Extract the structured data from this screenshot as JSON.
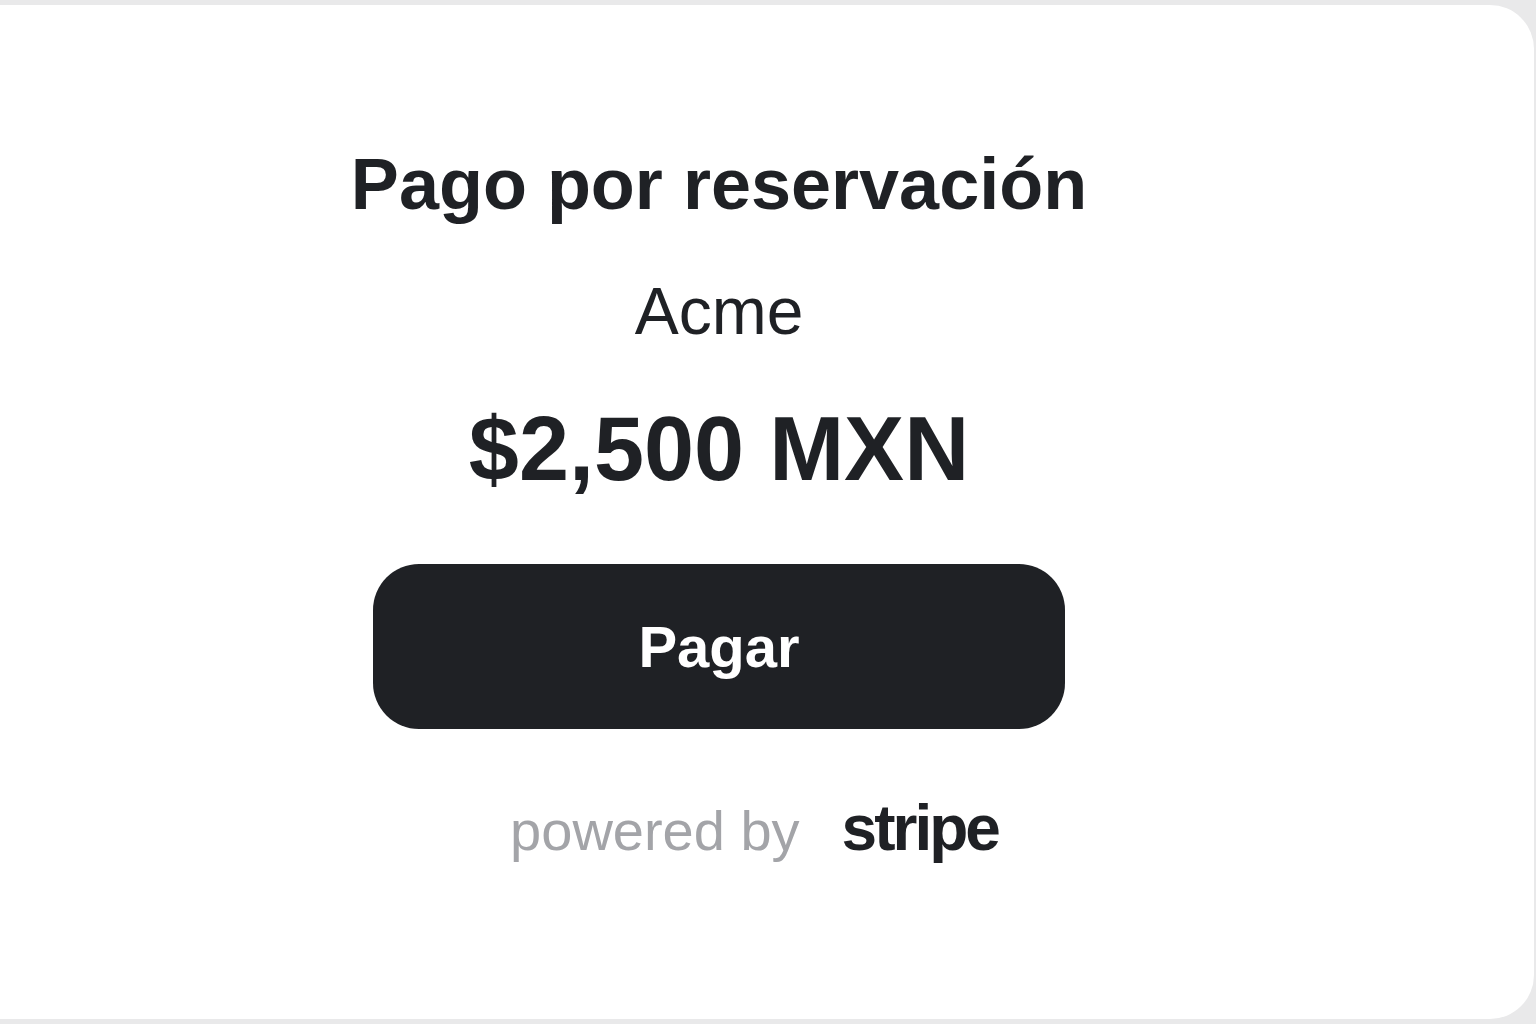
{
  "title": "Pago por reservación",
  "merchant": "Acme",
  "amount": "$2,500 MXN",
  "pay_button": "Pagar",
  "footer": {
    "powered_by": "powered by",
    "brand": "stripe"
  }
}
